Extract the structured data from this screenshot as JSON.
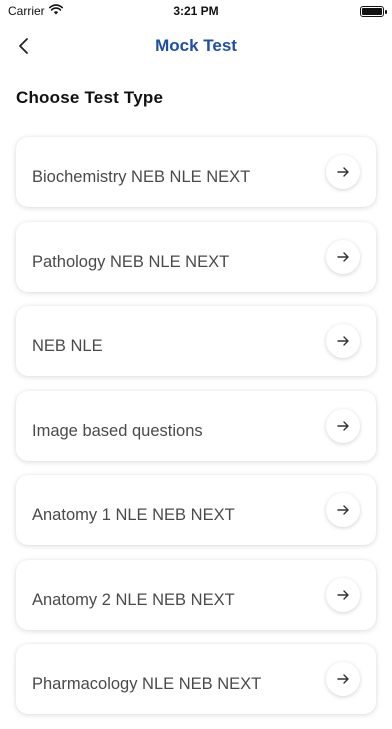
{
  "status_bar": {
    "carrier": "Carrier",
    "time": "3:21 PM"
  },
  "nav": {
    "title": "Mock Test"
  },
  "section": {
    "title": "Choose Test Type"
  },
  "test_types": [
    {
      "label": "Biochemistry NEB NLE NEXT"
    },
    {
      "label": "Pathology NEB NLE NEXT"
    },
    {
      "label": "NEB NLE"
    },
    {
      "label": "Image based questions"
    },
    {
      "label": "Anatomy 1 NLE NEB NEXT"
    },
    {
      "label": "Anatomy 2 NLE NEB NEXT"
    },
    {
      "label": "Pharmacology NLE NEB NEXT"
    }
  ],
  "icons": {
    "back": "chevron-left-icon",
    "item_action": "arrow-right-icon"
  },
  "colors": {
    "accent": "#1f4fa3",
    "card_text": "#4a4a4a"
  }
}
